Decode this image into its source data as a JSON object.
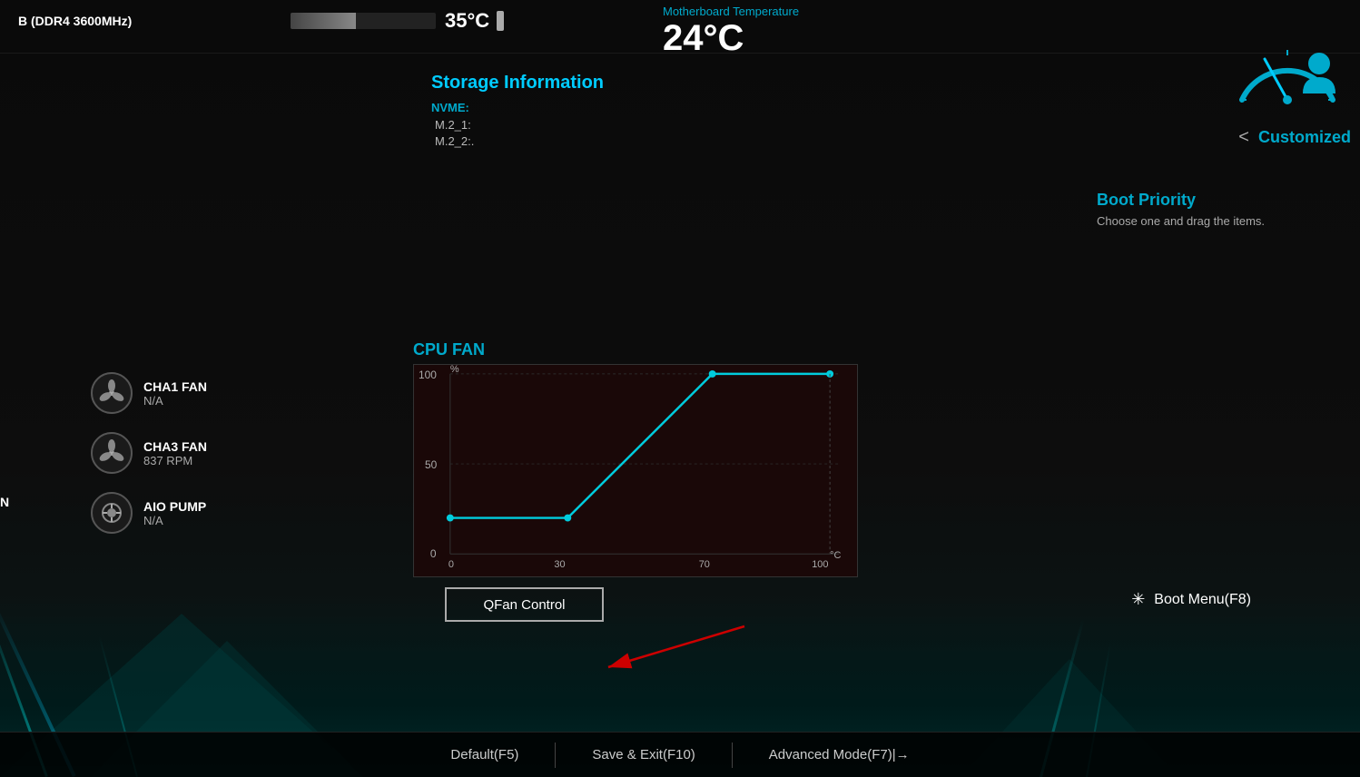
{
  "memory": {
    "label": "B (DDR4 3600MHz)"
  },
  "temperature": {
    "cpu_temp": "35°C",
    "mb_temp_label": "Motherboard Temperature",
    "mb_temp_value": "24°C",
    "bar_percent": 45
  },
  "storage": {
    "title": "Storage Information",
    "nvme_label": "NVME:",
    "m2_1_label": "M.2_1:",
    "m2_2_label": "M.2_2:.",
    "m2_1_value": "",
    "m2_2_value": ""
  },
  "customized": {
    "label": "Customized",
    "chevron": "<"
  },
  "boot_priority": {
    "title": "Boot Priority",
    "description": "Choose one and drag the items."
  },
  "fans": [
    {
      "name": "CHA1 FAN",
      "value": "N/A",
      "type": "fan"
    },
    {
      "name": "CHA3 FAN",
      "value": "837 RPM",
      "type": "fan"
    },
    {
      "name": "AIO PUMP",
      "value": "N/A",
      "type": "pump"
    }
  ],
  "left_label": "N",
  "cpu_fan": {
    "title": "CPU FAN",
    "y_label": "%",
    "x_axis": [
      "0",
      "30",
      "70",
      "100"
    ],
    "y_axis": [
      "0",
      "50",
      "100"
    ],
    "temp_label": "°C"
  },
  "qfan_button": {
    "label": "QFan Control"
  },
  "boot_menu": {
    "label": "Boot Menu(F8)"
  },
  "bottom_bar": {
    "default_label": "Default(F5)",
    "save_exit_label": "Save & Exit(F10)",
    "advanced_label": "Advanced Mode(F7)|→"
  }
}
